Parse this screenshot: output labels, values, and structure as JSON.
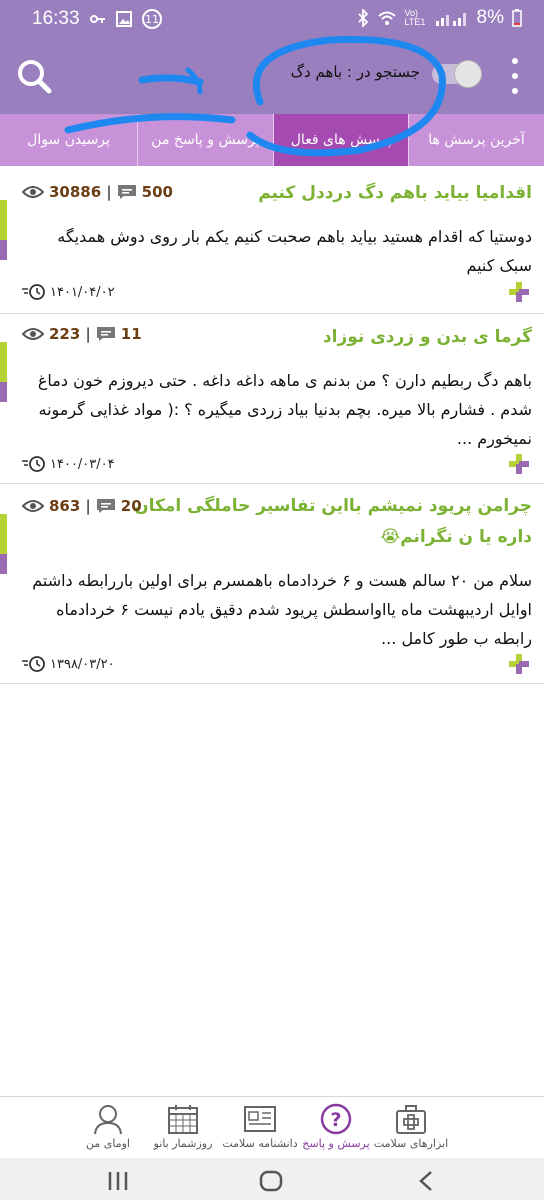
{
  "status_bar": {
    "time": "16:33",
    "notification_count": "11",
    "network": "Vo) LTE1",
    "battery": "8%"
  },
  "app_bar": {
    "search_label": "جستجو در : باهم دگ"
  },
  "tabs": [
    {
      "label": "آخرین پرسش ها"
    },
    {
      "label": "پرسش های فعال"
    },
    {
      "label": "پرسش و پاسخ من"
    },
    {
      "label": "پرسیدن سوال"
    }
  ],
  "posts": [
    {
      "title": "اقدامیا بیاید باهم دگ درددل کنیم",
      "comments": "500",
      "views": "30886",
      "body": "دوستیا که اقدام هستید بیاید باهم صحبت کنیم یکم بار روی دوش همدیگه سبک کنیم",
      "date": "۱۴۰۱/۰۴/۰۲"
    },
    {
      "title": "گرما ی بدن و زردی نوزاد",
      "comments": "11",
      "views": "223",
      "body": "باهم دگ ربطیم دارن ؟ من بدنم ی ماهه داغه داغه . حتی دیروزم خون دماغ شدم . فشارم بالا میره. بچم بدنیا بیاد زردی میگیره ؟ :(  مواد غذایی گرمونه نمیخورم ...",
      "date": "۱۴۰۰/۰۳/۰۴"
    },
    {
      "title": "چرامن پریود نمیشم بااین تفاسیر حاملگی امکان داره یا ن نگرانم😭",
      "comments": "20",
      "views": "863",
      "body": "سلام من ۲۰ سالم هست و ۶ خردادماه باهمسرم برای اولین باررابطه داشتم اوایل اردیبهشت ماه یااواسطش پریود شدم دقیق یادم نیست  ۶ خردادماه رابطه ب طور کامل ...",
      "date": "۱۳۹۸/۰۳/۲۰"
    }
  ],
  "bottom_nav": [
    {
      "label": "ابزارهای سلامت"
    },
    {
      "label": "پرسش و پاسخ"
    },
    {
      "label": "دانشنامه سلامت"
    },
    {
      "label": "روزشمار بانو"
    },
    {
      "label": "اومای من"
    }
  ],
  "colors": {
    "app_bar": "#9a7fbf",
    "tab_bar": "#c892d8",
    "tab_active": "#a44ab0",
    "title_green": "#7cb234",
    "stat_brown": "#6b3e16",
    "annotation_blue": "#1e88f0"
  }
}
